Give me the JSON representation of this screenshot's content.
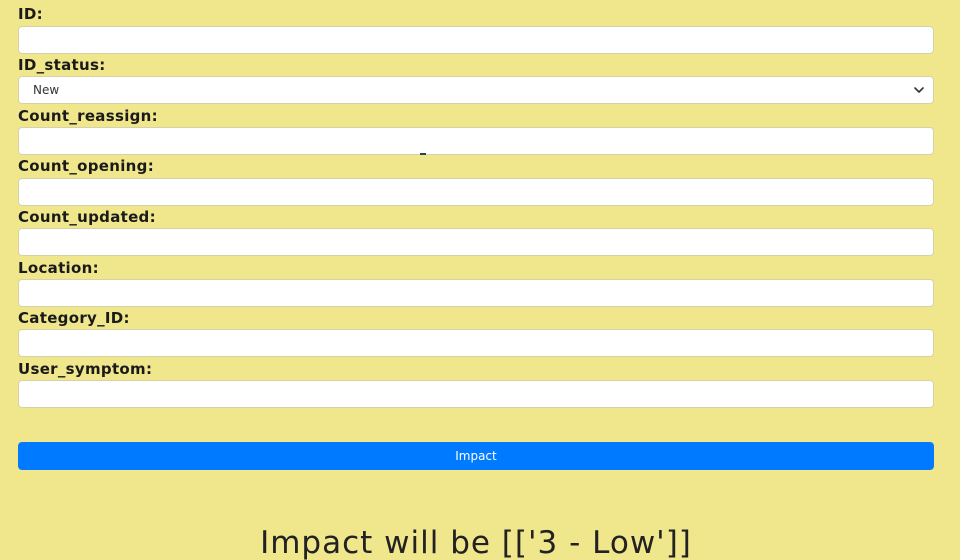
{
  "form": {
    "id_label": "ID:",
    "id_value": "",
    "id_status_label": "ID_status:",
    "id_status_selected": "New",
    "count_reassign_label": "Count_reassign:",
    "count_reassign_value": "",
    "count_opening_label": "Count_opening:",
    "count_opening_value": "",
    "count_updated_label": "Count_updated:",
    "count_updated_value": "",
    "location_label": "Location:",
    "location_value": "",
    "category_id_label": "Category_ID:",
    "category_id_value": "",
    "user_symptom_label": "User_symptom:",
    "user_symptom_value": "",
    "submit_label": "Impact"
  },
  "result": {
    "text": "Impact will be [['3 - Low']]"
  },
  "icons": {
    "select_arrow": "chevron-down-icon"
  },
  "colors": {
    "page_background": "#f0e68c",
    "button_background": "#007bff",
    "button_text": "#ffffff"
  }
}
